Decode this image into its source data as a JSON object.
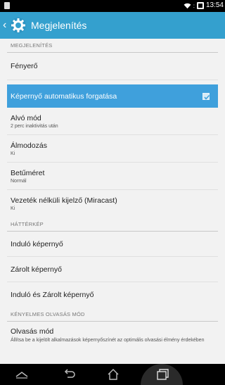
{
  "status_bar": {
    "time": "13:54"
  },
  "header": {
    "title": "Megjelenítés"
  },
  "sections": {
    "display": "MEGJELENÍTÉS",
    "wallpaper": "HÁTTÉRKÉP",
    "reading": "KÉNYELMES OLVASÁS MÓD"
  },
  "items": {
    "brightness": {
      "title": "Fényerő"
    },
    "auto_rotate": {
      "title": "Képernyő automatikus forgatása",
      "checked": true
    },
    "sleep": {
      "title": "Alvó mód",
      "summary": "2 perc inaktivitás után"
    },
    "daydream": {
      "title": "Álmodozás",
      "summary": "Ki"
    },
    "font_size": {
      "title": "Betűméret",
      "summary": "Normál"
    },
    "miracast": {
      "title": "Vezeték nélküli kijelző (Miracast)",
      "summary": "Ki"
    },
    "home_screen": {
      "title": "Induló képernyő"
    },
    "lock_screen": {
      "title": "Zárolt képernyő"
    },
    "home_lock_screen": {
      "title": "Induló és Zárolt képernyő"
    },
    "reading_mode": {
      "title": "Olvasás mód",
      "summary": "Állítsa be a kijelölt alkalmazások képernyőszínét az optimális olvasási élmény érdekében"
    }
  },
  "colors": {
    "accent": "#34a0ce",
    "selected": "#3fa0dc"
  },
  "icons": [
    "back-icon",
    "settings-gear-icon",
    "wifi-icon",
    "battery-icon",
    "checkbox-icon",
    "hide-keyboard-icon",
    "back-nav-icon",
    "home-icon",
    "recent-apps-icon"
  ]
}
